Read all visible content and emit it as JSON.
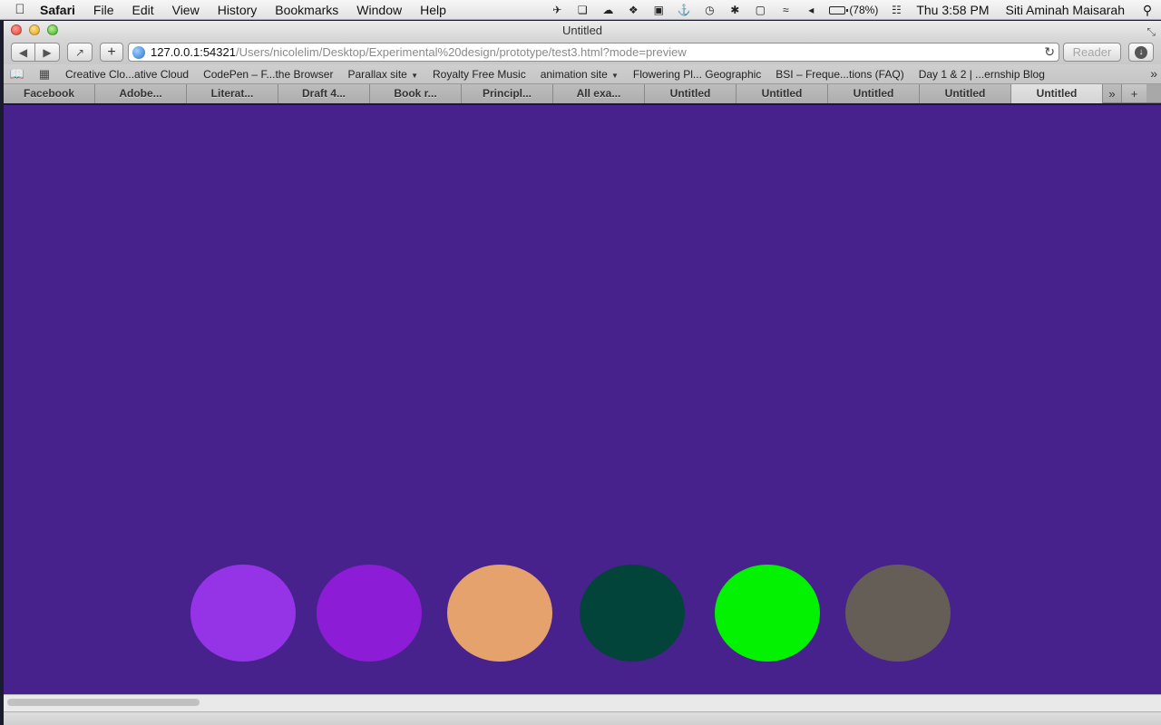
{
  "menubar": {
    "apple": "",
    "app_name": "Safari",
    "menus": [
      "File",
      "Edit",
      "View",
      "History",
      "Bookmarks",
      "Window",
      "Help"
    ],
    "battery_percent": "(78%)",
    "battery_level": 0.78,
    "clock": "Thu 3:58 PM",
    "user": "Siti Aminah Maisarah",
    "tray_icons": [
      "evernote-icon",
      "screen-capture-icon",
      "creative-cloud-icon",
      "dropbox-icon",
      "app-icon",
      "alfred-icon",
      "time-machine-icon",
      "bluetooth-icon",
      "display-icon",
      "wifi-icon",
      "volume-icon"
    ]
  },
  "window": {
    "title": "Untitled"
  },
  "toolbar": {
    "back": "◀",
    "forward": "▶",
    "add": "+",
    "url_host": "127.0.0.1:54321",
    "url_path": "/Users/nicolelim/Desktop/Experimental%20design/prototype/test3.html?mode=preview",
    "reader": "Reader"
  },
  "bookmarks": [
    {
      "label": "Creative Clo...ative Cloud",
      "menu": false
    },
    {
      "label": "CodePen – F...the Browser",
      "menu": false
    },
    {
      "label": "Parallax site",
      "menu": true
    },
    {
      "label": "Royalty Free Music",
      "menu": false
    },
    {
      "label": "animation site",
      "menu": true
    },
    {
      "label": "Flowering Pl... Geographic",
      "menu": false
    },
    {
      "label": "BSI – Freque...tions (FAQ)",
      "menu": false
    },
    {
      "label": "Day 1 & 2 | ...ernship Blog",
      "menu": false
    }
  ],
  "tabs": [
    {
      "label": "Facebook"
    },
    {
      "label": "Adobe..."
    },
    {
      "label": "Literat..."
    },
    {
      "label": "Draft 4..."
    },
    {
      "label": "Book r..."
    },
    {
      "label": "Principl..."
    },
    {
      "label": "All exa..."
    },
    {
      "label": "Untitled"
    },
    {
      "label": "Untitled"
    },
    {
      "label": "Untitled"
    },
    {
      "label": "Untitled"
    },
    {
      "label": "Untitled",
      "active": true
    }
  ],
  "page": {
    "background": "#48228c",
    "circle_colors": [
      "#9533e6",
      "#8c1cd6",
      "#e6a26d",
      "#024439",
      "#02f202",
      "#655e56"
    ]
  }
}
